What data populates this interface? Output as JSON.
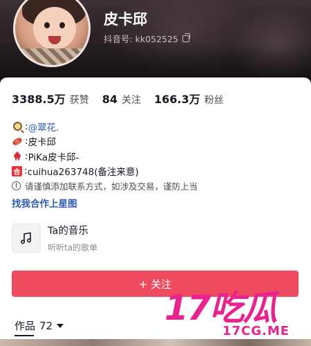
{
  "profile": {
    "name": "皮卡邱",
    "douyin_id": "抖音号: kk052525"
  },
  "stats": [
    {
      "value": "3388.5万",
      "label": "获赞"
    },
    {
      "value": "84",
      "label": "关注"
    },
    {
      "value": "166.3万",
      "label": "粉丝"
    }
  ],
  "bio": {
    "lines": [
      {
        "icon": "magnifier-icon",
        "prefix": ":",
        "text": "@翠花."
      },
      {
        "icon": "sweet-potato-icon",
        "prefix": ":",
        "text": "皮卡邱"
      },
      {
        "icon": "ribbon-icon",
        "prefix": ":",
        "text": "PiKa皮卡邱-"
      },
      {
        "icon": "he-badge-icon",
        "badge_text": "合",
        "prefix": ":",
        "text": " cuihua263748(备注来意)"
      }
    ],
    "warning": "请谨慎添加联系方式，如涉及交易，谨防上当",
    "warning_icon_text": "!",
    "link": "找我合作上星图"
  },
  "music": {
    "title": "Ta的音乐",
    "subtitle": "听听ta的歌单"
  },
  "follow_button": {
    "label": "+ 关注"
  },
  "works": {
    "label": "作品",
    "count": "72"
  },
  "watermark": {
    "big": "17吃瓜",
    "small": "17CG.ME"
  },
  "colors": {
    "accent": "#ee4c5e",
    "link": "#2f5bb3",
    "watermark": "#e8238f"
  }
}
